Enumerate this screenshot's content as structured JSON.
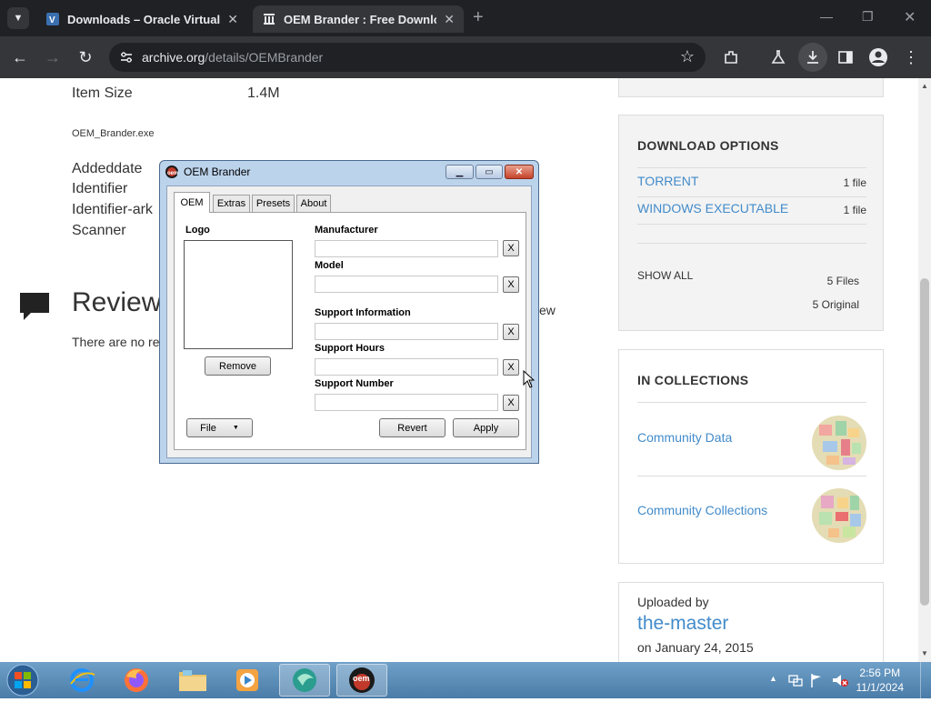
{
  "browser": {
    "tabs": [
      {
        "title": "Downloads – Oracle VirtualBox"
      },
      {
        "title": "OEM Brander : Free Download"
      }
    ],
    "new_tab": "+",
    "url": {
      "host": "archive.org",
      "path": "/details/OEMBrander"
    }
  },
  "page": {
    "item_size_label": "Item Size",
    "item_size_value": "1.4M",
    "filename": "OEM_Brander.exe",
    "meta_labels": [
      "Addeddate",
      "Identifier",
      "Identifier-ark",
      "Scanner"
    ],
    "reviews_title": "Review",
    "reviews_empty": "There are no re",
    "reviews_link_fragment": "ew",
    "download_options": {
      "heading": "DOWNLOAD OPTIONS",
      "rows": [
        {
          "label": "TORRENT",
          "count": "1 file"
        },
        {
          "label": "WINDOWS EXECUTABLE",
          "count": "1 file"
        }
      ],
      "show_all": "SHOW ALL",
      "total_files": "5 Files",
      "total_original": "5 Original"
    },
    "collections": {
      "heading": "IN COLLECTIONS",
      "items": [
        {
          "label": "Community Data"
        },
        {
          "label": "Community Collections"
        }
      ]
    },
    "uploader": {
      "label": "Uploaded by",
      "name": "the-master",
      "date": "on January 24, 2015"
    }
  },
  "dialog": {
    "title": "OEM Brander",
    "tabs": [
      "OEM",
      "Extras",
      "Presets",
      "About"
    ],
    "logo_label": "Logo",
    "remove_label": "Remove",
    "fields": [
      {
        "label": "Manufacturer",
        "value": "",
        "clear": "X"
      },
      {
        "label": "Model",
        "value": "",
        "clear": "X"
      },
      {
        "label": "Support Information",
        "value": "",
        "clear": "X"
      },
      {
        "label": "Support Hours",
        "value": "",
        "clear": "X"
      },
      {
        "label": "Support Number",
        "value": "",
        "clear": "X"
      }
    ],
    "file_label": "File",
    "revert_label": "Revert",
    "apply_label": "Apply"
  },
  "taskbar": {
    "time": "2:56 PM",
    "date": "11/1/2024"
  },
  "colors": {
    "link": "#428bca",
    "chrome_dark": "#202124",
    "taskbar": "#4a7ca8"
  }
}
